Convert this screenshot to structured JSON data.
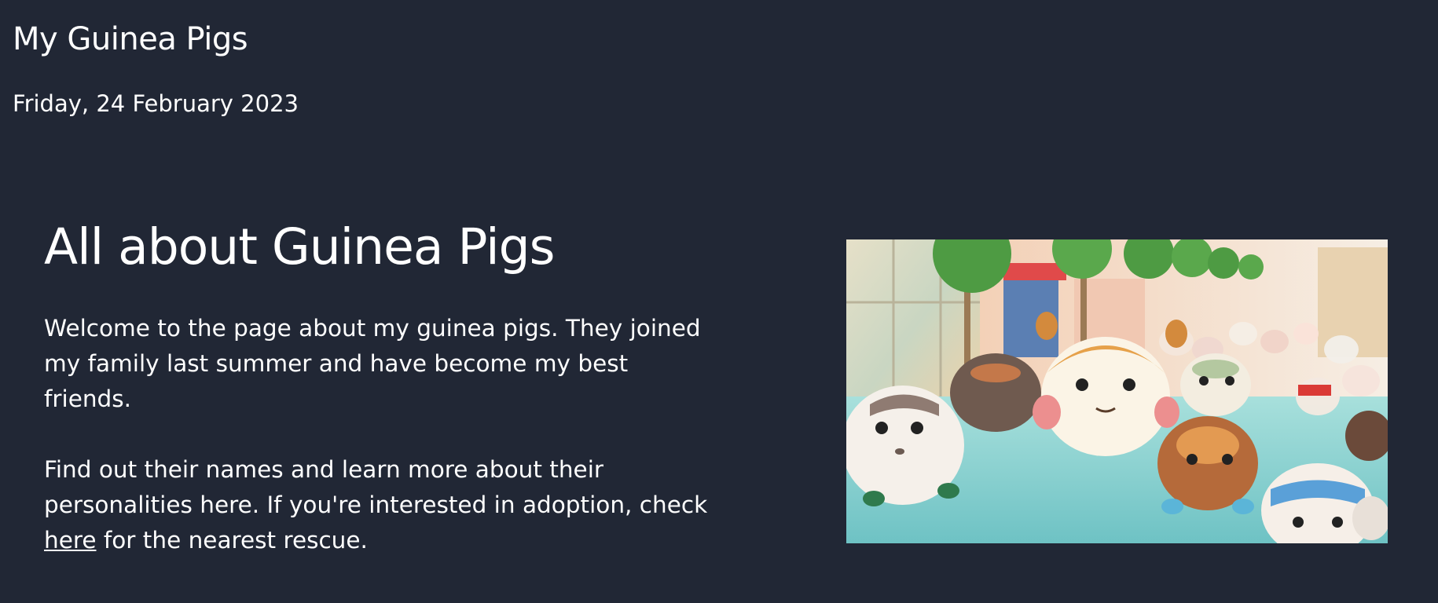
{
  "header": {
    "site_title": "My Guinea Pigs",
    "date": "Friday, 24 February 2023"
  },
  "intro": {
    "heading": "All about Guinea Pigs",
    "paragraph1_lines": [
      "Welcome to the page about my guinea pigs. They joined",
      "my family last summer and have become my best",
      "friends."
    ],
    "paragraph2_lines": [
      "Find out their names and learn more about their",
      "personalities here. If you're interested in adoption, check"
    ],
    "link_text": "here",
    "after_link_text": " for the nearest rescue."
  },
  "hero_image": {
    "icon": "photo-felt-guinea-pigs"
  },
  "colors": {
    "background": "#212735",
    "text": "#ffffff"
  }
}
